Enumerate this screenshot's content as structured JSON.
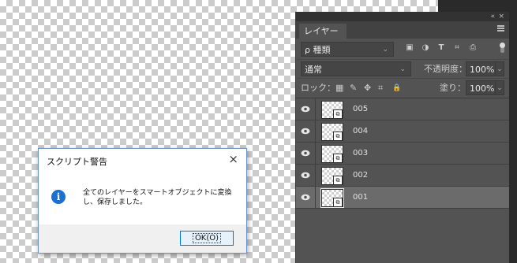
{
  "panel": {
    "collapse_label": "«",
    "close_label": "×",
    "tab_label": "レイヤー",
    "filter": {
      "label": "ρ 種類",
      "chevron": "⌄",
      "icons": [
        "▣",
        "◑",
        "T",
        "⌗",
        "⎙"
      ]
    },
    "blend": {
      "mode": "通常",
      "chevron": "⌄",
      "opacity_label": "不透明度：",
      "opacity_value": "100%"
    },
    "lock": {
      "label": "ロック：",
      "icons": [
        "▦",
        "✎",
        "✥",
        "⌗",
        "🔒"
      ],
      "fill_label": "塗り：",
      "fill_value": "100%"
    },
    "layers": [
      {
        "name": "005",
        "selected": false
      },
      {
        "name": "004",
        "selected": false
      },
      {
        "name": "003",
        "selected": false
      },
      {
        "name": "002",
        "selected": false
      },
      {
        "name": "001",
        "selected": true
      }
    ]
  },
  "dialog": {
    "title": "スクリプト警告",
    "close": "×",
    "info_glyph": "i",
    "message": "全てのレイヤーをスマートオブジェクトに変換し、保存しました。",
    "ok_label": "OK(O)"
  }
}
